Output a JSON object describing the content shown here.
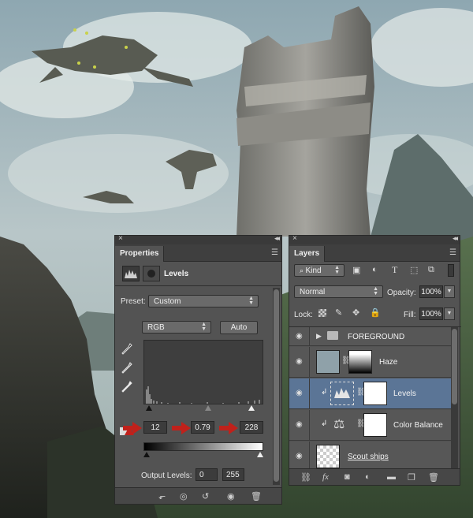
{
  "properties_panel": {
    "tab": "Properties",
    "adjustment_title": "Levels",
    "preset_label": "Preset:",
    "preset_value": "Custom",
    "channel_value": "RGB",
    "auto_button": "Auto",
    "input_shadow": "12",
    "input_midtone": "0.79",
    "input_highlight": "228",
    "output_label": "Output Levels:",
    "output_black": "0",
    "output_white": "255"
  },
  "layers_panel": {
    "tab": "Layers",
    "filter_kind": "Kind",
    "blend_mode": "Normal",
    "opacity_label": "Opacity:",
    "opacity_value": "100%",
    "lock_label": "Lock:",
    "fill_label": "Fill:",
    "fill_value": "100%",
    "layers": [
      {
        "name": "FOREGROUND",
        "type": "group"
      },
      {
        "name": "Haze",
        "type": "adjustment"
      },
      {
        "name": "Levels",
        "type": "adjustment",
        "selected": true
      },
      {
        "name": "Color Balance",
        "type": "adjustment"
      },
      {
        "name": "Scout ships",
        "type": "pixel"
      }
    ]
  },
  "colors": {
    "panel_bg": "#535353",
    "selected_layer": "#5b7596",
    "arrow_red": "#c0211b"
  }
}
